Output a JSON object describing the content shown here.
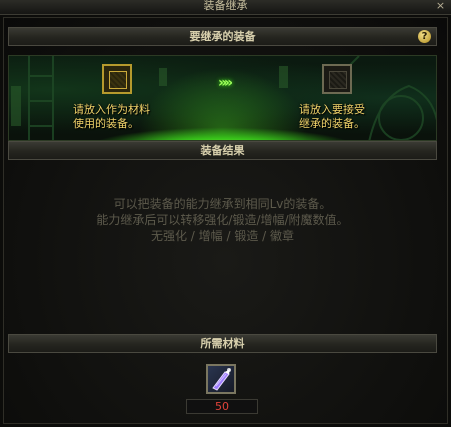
{
  "window": {
    "title": "装备继承",
    "close_label": "×"
  },
  "inherit_section": {
    "header": "要继承的装备",
    "help_label": "?",
    "source_hint_line1": "请放入作为材料",
    "source_hint_line2": "使用的装备。",
    "target_hint_line1": "请放入要接受",
    "target_hint_line2": "继承的装备。",
    "arrows": "»»"
  },
  "result_section": {
    "header": "装备结果",
    "line1": "可以把装备的能力继承到相同Lv的装备。",
    "line2": "能力继承后可以转移强化/锻造/增幅/附魔数值。",
    "line3": "无强化 / 增幅 / 锻造 / 徽章"
  },
  "materials_section": {
    "header": "所需材料",
    "item_icon": "crystal-material-icon",
    "quantity": "50"
  },
  "colors": {
    "hint_text": "#f0d36a",
    "quantity_text": "#e0433a",
    "glow": "#4aff1a"
  }
}
